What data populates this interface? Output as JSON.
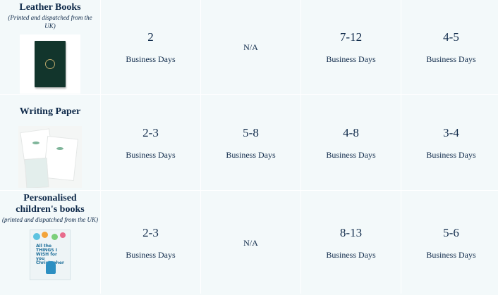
{
  "rows": [
    {
      "title": "Leather Books",
      "subtitle": "(Printed and dispatched from the UK)",
      "thumbnail_icon": "leather-notebook-image",
      "times": [
        {
          "value": "2",
          "unit": "Business Days"
        },
        {
          "value": "N/A",
          "unit": ""
        },
        {
          "value": "7-12",
          "unit": "Business Days"
        },
        {
          "value": "4-5",
          "unit": "Business Days"
        }
      ]
    },
    {
      "title": "Writing Paper",
      "subtitle": "",
      "thumbnail_icon": "writing-paper-image",
      "times": [
        {
          "value": "2-3",
          "unit": "Business Days"
        },
        {
          "value": "5-8",
          "unit": "Business Days"
        },
        {
          "value": "4-8",
          "unit": "Business Days"
        },
        {
          "value": "3-4",
          "unit": "Business Days"
        }
      ]
    },
    {
      "title": "Personalised children's books",
      "subtitle": "(printed and dispatched from the UK)",
      "thumbnail_icon": "childrens-book-image",
      "thumbnail_text": "All the THINGS I WISH for you Christopher",
      "times": [
        {
          "value": "2-3",
          "unit": "Business Days"
        },
        {
          "value": "N/A",
          "unit": ""
        },
        {
          "value": "8-13",
          "unit": "Business Days"
        },
        {
          "value": "5-6",
          "unit": "Business Days"
        }
      ]
    }
  ],
  "colors": {
    "text": "#0f2a4a",
    "cell_background": "#f3f9fa",
    "grid_lines": "#ffffff"
  }
}
